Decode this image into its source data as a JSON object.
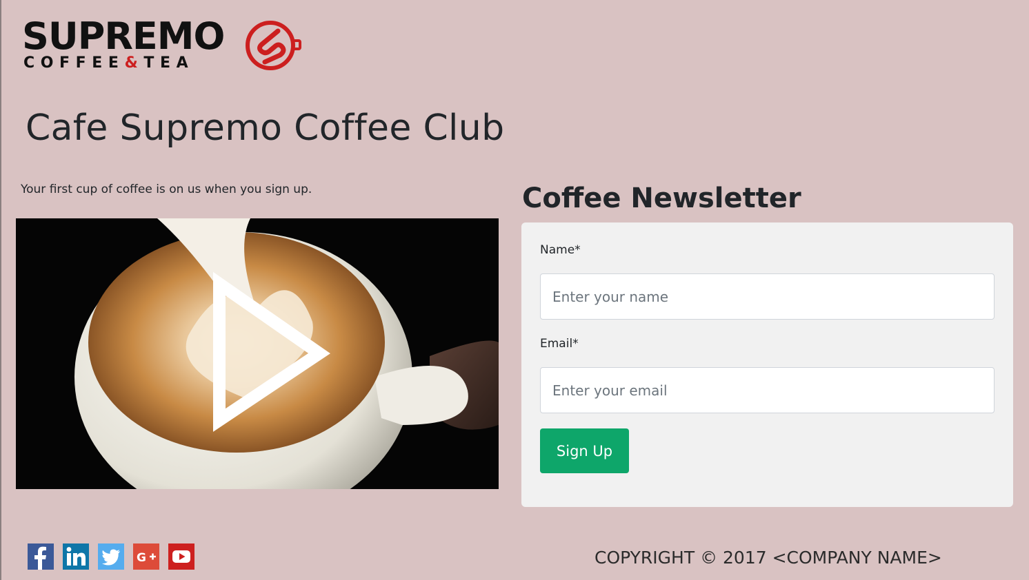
{
  "brand": {
    "logo_word": "SUPREMO",
    "logo_sub_left": "COFFEE",
    "logo_sub_amp": "&",
    "logo_sub_right": "TEA",
    "accent_color": "#cc1f1f"
  },
  "hero": {
    "title": "Cafe Supremo Coffee Club",
    "tagline": "Your first cup of coffee is on us when you sign up."
  },
  "video": {
    "play_icon": "play-icon"
  },
  "newsletter": {
    "title": "Coffee Newsletter",
    "name_label": "Name*",
    "name_placeholder": "Enter your name",
    "email_label": "Email*",
    "email_placeholder": "Enter your email",
    "submit_label": "Sign Up",
    "submit_color": "#0ea66a"
  },
  "footer": {
    "social": [
      {
        "name": "facebook-icon",
        "color": "#3b5998"
      },
      {
        "name": "linkedin-icon",
        "color": "#0e76a8"
      },
      {
        "name": "twitter-icon",
        "color": "#55acee"
      },
      {
        "name": "google-plus-icon",
        "color": "#dd4b39"
      },
      {
        "name": "youtube-icon",
        "color": "#cd201f"
      }
    ],
    "copyright": "COPYRIGHT © 2017 <COMPANY NAME>"
  }
}
